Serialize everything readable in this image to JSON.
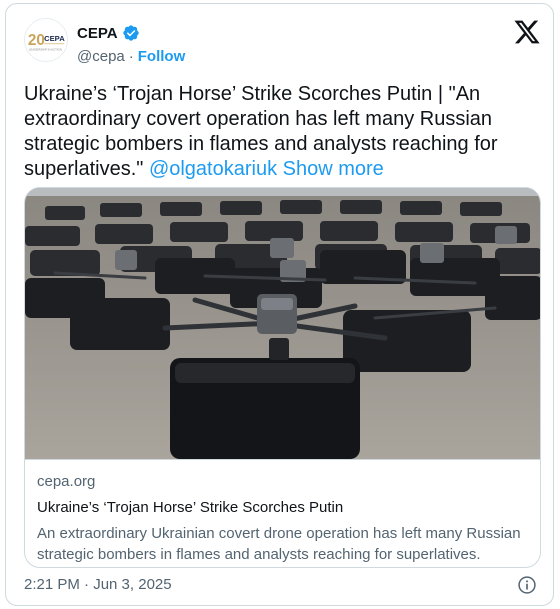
{
  "author": {
    "display_name": "CEPA",
    "handle": "@cepa",
    "separator": "·",
    "follow_label": "Follow",
    "avatar_text": "CEPA",
    "avatar_sub": "LEADERSHIP IN ACTION",
    "verified_color": "#1d9bf0"
  },
  "tweet": {
    "text_main": "Ukraine’s ‘Trojan Horse’ Strike Scorches Putin | \"An extraordinary covert operation has left many Russian strategic bombers in flames and analysts reaching for superlatives.\"",
    "mention": "@olgatokariuk",
    "show_more": "Show more"
  },
  "link_card": {
    "domain": "cepa.org",
    "title": "Ukraine’s ‘Trojan Horse’ Strike Scorches Putin",
    "description": "An extraordinary Ukrainian covert drone operation has left many Russian strategic bombers in flames and analysts reaching for superlatives."
  },
  "footer": {
    "timestamp": "2:21 PM · Jun 3, 2025"
  },
  "icons": {
    "platform": "x-logo-icon",
    "verified": "verified-badge-icon",
    "info": "info-icon"
  }
}
